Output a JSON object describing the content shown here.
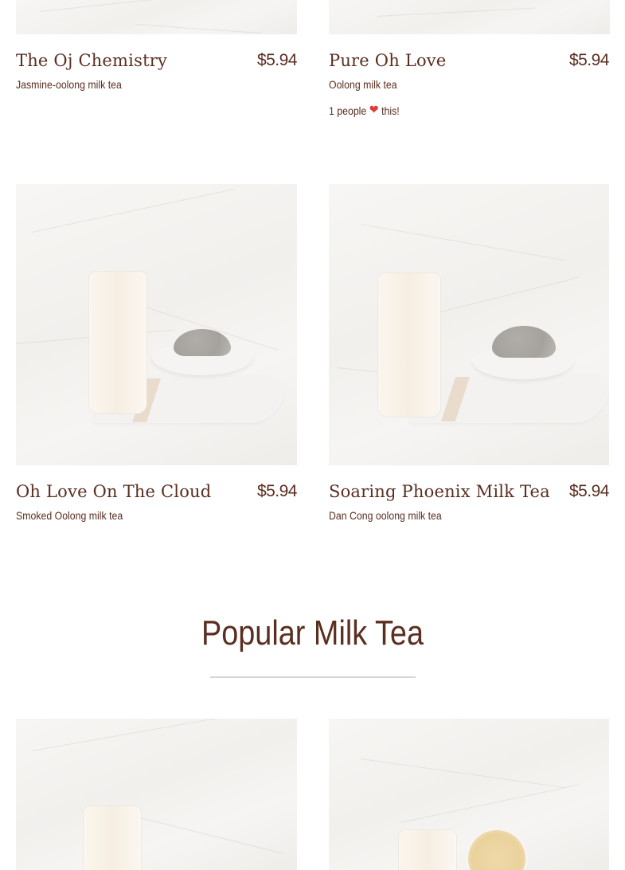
{
  "products": [
    {
      "title": "The Oj Chemistry",
      "price": "$5.94",
      "description": "Jasmine-oolong milk tea"
    },
    {
      "title": "Pure Oh Love",
      "price": "$5.94",
      "description": "Oolong milk tea",
      "likes": {
        "count_text": "1 people",
        "suffix": "this!",
        "icon": "heart-icon"
      }
    },
    {
      "title": "Oh Love On The Cloud",
      "price": "$5.94",
      "description": "Smoked Oolong milk tea"
    },
    {
      "title": "Soaring Phoenix Milk Tea",
      "price": "$5.94",
      "description": "Dan Cong oolong milk tea"
    }
  ],
  "section": {
    "title": "Popular Milk Tea"
  },
  "colors": {
    "text": "#5a2e20",
    "heart": "#e03b3b",
    "rule": "#d8d4d1"
  }
}
